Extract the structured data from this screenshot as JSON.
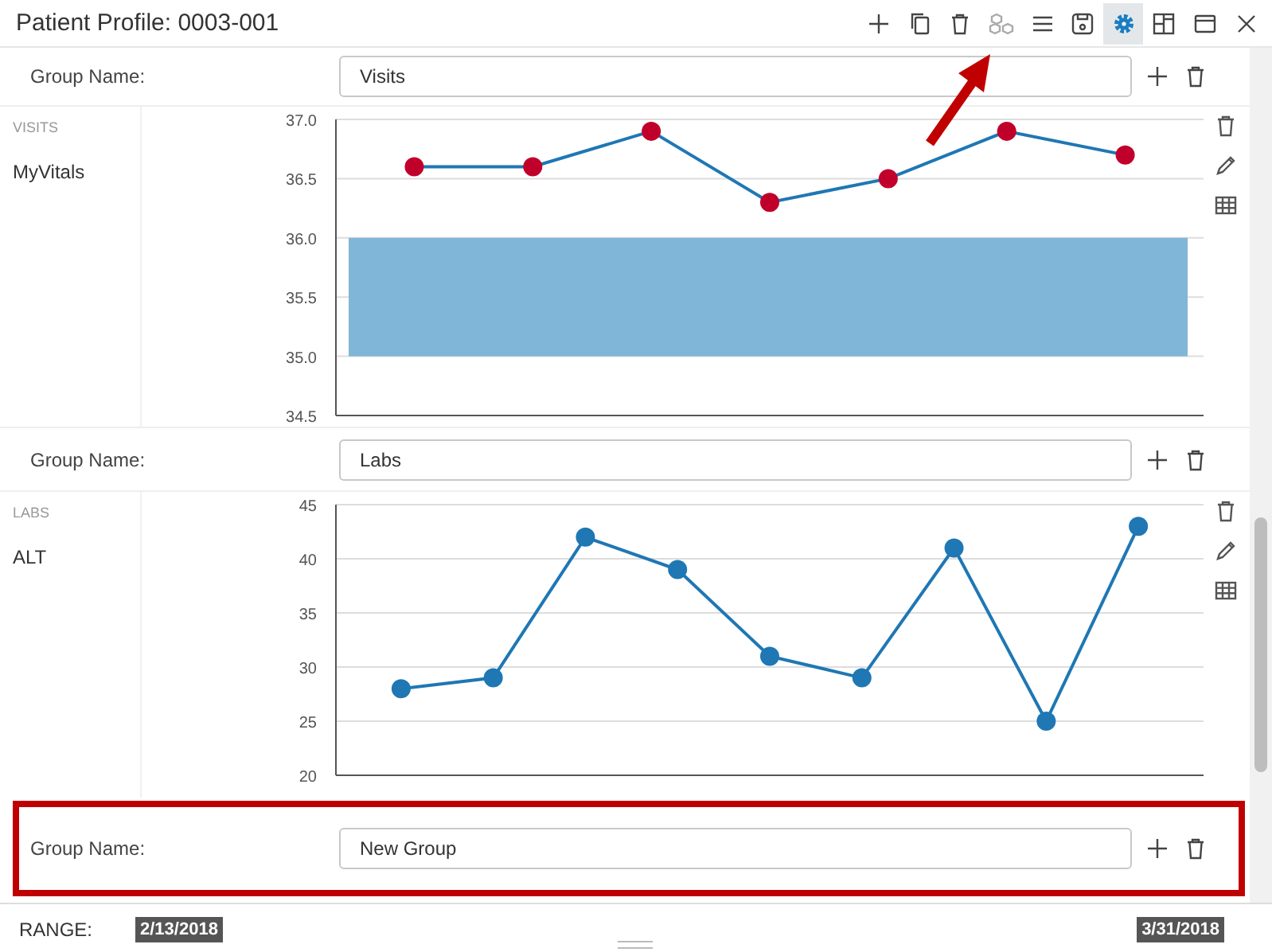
{
  "window": {
    "title": "Patient Profile: 0003-001"
  },
  "toolbar": [
    {
      "kind": "add",
      "selected": false,
      "disabled": false
    },
    {
      "kind": "copy",
      "selected": false,
      "disabled": false
    },
    {
      "kind": "delete",
      "selected": false,
      "disabled": false
    },
    {
      "kind": "cubes",
      "selected": false,
      "disabled": true,
      "pointed": true
    },
    {
      "kind": "menu",
      "selected": false,
      "disabled": false
    },
    {
      "kind": "save",
      "selected": false,
      "disabled": false
    },
    {
      "kind": "settings",
      "selected": true,
      "disabled": false
    },
    {
      "kind": "layout",
      "selected": false,
      "disabled": false
    },
    {
      "kind": "window",
      "selected": false,
      "disabled": false
    },
    {
      "kind": "close",
      "selected": false,
      "disabled": false
    }
  ],
  "groups": [
    {
      "label": "Group Name:",
      "value": "Visits",
      "highlighted": false,
      "category": "VISITS",
      "color": "#c0002a",
      "chart_data": {
        "type": "line",
        "grid": true,
        "ylim": [
          34.5,
          37.0
        ],
        "yticks": [
          {
            "value": 34.5,
            "label": "34.5"
          },
          {
            "value": 35,
            "label": "35.0"
          },
          {
            "value": 35.5,
            "label": "35.5"
          },
          {
            "value": 36,
            "label": "36.0"
          },
          {
            "value": 36.5,
            "label": "36.5"
          },
          {
            "value": 37,
            "label": "37.0"
          }
        ],
        "categories": [
          null,
          null,
          null,
          null,
          null,
          null,
          null
        ],
        "series": [
          {
            "name": "MyVitals",
            "color": "#1f77b4",
            "marker": "circle",
            "values": [
              36.6,
              36.6,
              36.9,
              36.3,
              36.5,
              36.9,
              36.7
            ]
          }
        ],
        "bands": [
          {
            "axis": "y",
            "from": 35.0,
            "to": 36.0,
            "color": "#80b6d8"
          }
        ]
      }
    },
    {
      "label": "Group Name:",
      "value": "Labs",
      "highlighted": false,
      "category": "LABS",
      "color": "#1f77b4",
      "chart_data": {
        "type": "line",
        "grid": true,
        "ylim": [
          20,
          45
        ],
        "yticks": [
          {
            "value": 20,
            "label": "20"
          },
          {
            "value": 25,
            "label": "25"
          },
          {
            "value": 30,
            "label": "30"
          },
          {
            "value": 35,
            "label": "35"
          },
          {
            "value": 40,
            "label": "40"
          },
          {
            "value": 45,
            "label": "45"
          }
        ],
        "categories": [
          null,
          null,
          null,
          null,
          null,
          null,
          null,
          null,
          null
        ],
        "series": [
          {
            "name": "ALT",
            "color": "#1f77b4",
            "marker": "circle",
            "values": [
              28,
              29,
              42,
              39,
              31,
              29,
              41,
              25,
              43
            ]
          }
        ]
      }
    },
    {
      "label": "Group Name:",
      "value": "New Group",
      "highlighted": true
    }
  ],
  "range": {
    "label": "RANGE:",
    "start": "2/13/2018",
    "end": "3/31/2018"
  }
}
